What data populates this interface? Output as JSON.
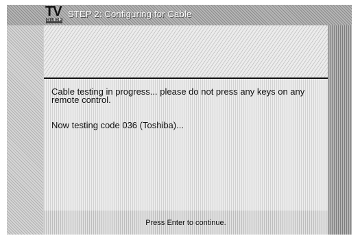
{
  "header": {
    "logo_text": "TV",
    "logo_subtext": "GUIDE",
    "title": "STEP 2: Configuring for Cable"
  },
  "main": {
    "message": "Cable testing in progress... please do not press any keys on any remote control.",
    "status": "Now testing code 036 (Toshiba)..."
  },
  "footer": {
    "hint": "Press Enter to continue."
  },
  "colors": {
    "header_text": "#ffffff",
    "body_text": "#111111",
    "divider": "#111111"
  },
  "icons": {
    "logo": "tv-guide-logo-icon"
  }
}
